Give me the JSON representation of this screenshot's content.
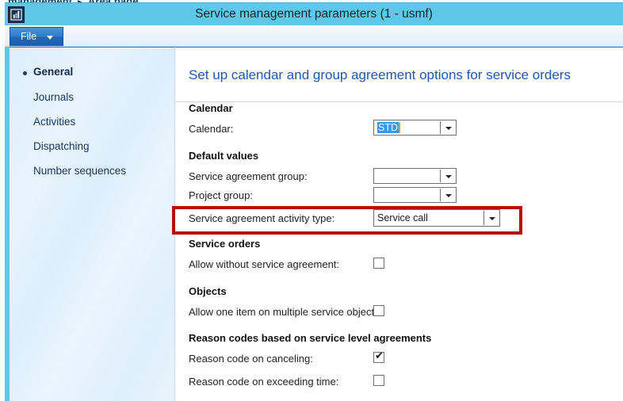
{
  "background": {
    "breadcrumb_partial": "management",
    "breadcrumb_separator": "▸",
    "breadcrumb_page": "Area page"
  },
  "window": {
    "title": "Service management parameters (1 - usmf)",
    "app_icon": "window-app-icon"
  },
  "ribbon": {
    "file_label": "File",
    "file_dropdown_icon": "chevron-down-icon"
  },
  "sidebar": {
    "items": [
      {
        "label": "General",
        "selected": true
      },
      {
        "label": "Journals",
        "selected": false
      },
      {
        "label": "Activities",
        "selected": false
      },
      {
        "label": "Dispatching",
        "selected": false
      },
      {
        "label": "Number sequences",
        "selected": false
      }
    ]
  },
  "content": {
    "heading": "Set up calendar and group agreement options for service orders",
    "groups": {
      "calendar": {
        "title": "Calendar",
        "calendar_label": "Calendar:",
        "calendar_value": "STD",
        "calendar_value_selected": true
      },
      "default_values": {
        "title": "Default values",
        "service_agreement_group_label": "Service agreement group:",
        "service_agreement_group_value": "",
        "project_group_label": "Project group:",
        "project_group_value": "",
        "service_agreement_activity_type_label": "Service agreement activity type:",
        "service_agreement_activity_type_value": "Service call"
      },
      "service_orders": {
        "title": "Service orders",
        "allow_without_service_agreement_label": "Allow without service agreement:",
        "allow_without_service_agreement_checked": false
      },
      "objects": {
        "title": "Objects",
        "allow_one_item_label": "Allow one item on multiple service objects:",
        "allow_one_item_checked": false
      },
      "reason_codes": {
        "title": "Reason codes based on service level agreements",
        "reason_code_on_canceling_label": "Reason code on canceling:",
        "reason_code_on_canceling_checked": true,
        "reason_code_on_exceeding_time_label": "Reason code on exceeding time:",
        "reason_code_on_exceeding_time_checked": false
      }
    }
  },
  "annotation": {
    "highlight_color": "#b80d0d",
    "highlighted_field": "Service agreement activity type"
  },
  "checkmark_glyph": "✔",
  "colors": {
    "titlebar": "#5ec8e8",
    "heading_text": "#1f56b4",
    "file_button": "#2f7ccb",
    "selection_blue": "#3399ff",
    "sidebar_bg": "#e4f1fb"
  }
}
